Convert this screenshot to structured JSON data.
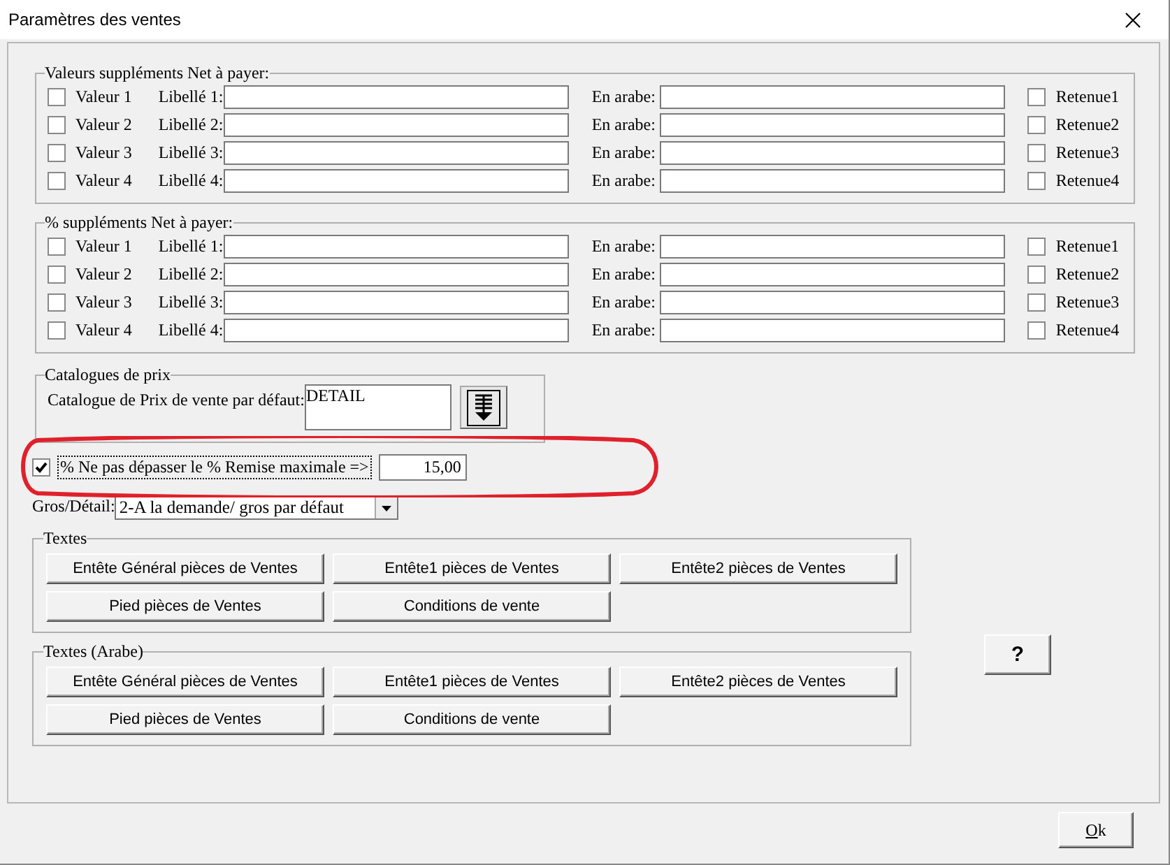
{
  "window": {
    "title": "Paramètres des ventes"
  },
  "supplement_groups": [
    {
      "title": "Valeurs suppléments Net à payer:",
      "rows": [
        {
          "checked": false,
          "label": "Valeur 1",
          "libelle": "Libellé 1:",
          "arabe": "En arabe:",
          "retenue_checked": false,
          "retenue": "Retenue1"
        },
        {
          "checked": false,
          "label": "Valeur 2",
          "libelle": "Libellé 2:",
          "arabe": "En arabe:",
          "retenue_checked": false,
          "retenue": "Retenue2"
        },
        {
          "checked": false,
          "label": "Valeur 3",
          "libelle": "Libellé 3:",
          "arabe": "En arabe:",
          "retenue_checked": false,
          "retenue": "Retenue3"
        },
        {
          "checked": false,
          "label": "Valeur 4",
          "libelle": "Libellé 4:",
          "arabe": "En arabe:",
          "retenue_checked": false,
          "retenue": "Retenue4"
        }
      ]
    },
    {
      "title": "% suppléments Net à payer:",
      "rows": [
        {
          "checked": false,
          "label": "Valeur 1",
          "libelle": "Libellé 1:",
          "arabe": "En arabe:",
          "retenue_checked": false,
          "retenue": "Retenue1"
        },
        {
          "checked": false,
          "label": "Valeur 2",
          "libelle": "Libellé 2:",
          "arabe": "En arabe:",
          "retenue_checked": false,
          "retenue": "Retenue2"
        },
        {
          "checked": false,
          "label": "Valeur 3",
          "libelle": "Libellé 3:",
          "arabe": "En arabe:",
          "retenue_checked": false,
          "retenue": "Retenue3"
        },
        {
          "checked": false,
          "label": "Valeur 4",
          "libelle": "Libellé 4:",
          "arabe": "En arabe:",
          "retenue_checked": false,
          "retenue": "Retenue4"
        }
      ]
    }
  ],
  "catalogue": {
    "title": "Catalogues de prix",
    "label": "Catalogue de Prix de vente par défaut:",
    "value": "DETAIL"
  },
  "remise": {
    "checked": true,
    "focused": true,
    "label": "% Ne pas dépasser le % Remise maximale =>",
    "value": "15,00"
  },
  "gros_detail": {
    "label": "Gros/Détail:",
    "value": "2-A la demande/ gros par défaut"
  },
  "text_groups": [
    {
      "title": "Textes",
      "buttons": [
        "Entête Général pièces de Ventes",
        "Entête1 pièces de Ventes",
        "Entête2 pièces de Ventes",
        "Pied pièces de Ventes",
        "Conditions de vente"
      ]
    },
    {
      "title": "Textes (Arabe)",
      "buttons": [
        "Entête Général pièces de Ventes",
        "Entête1 pièces de Ventes",
        "Entête2 pièces de Ventes",
        "Pied pièces de Ventes",
        "Conditions de vente"
      ]
    }
  ],
  "help_button": "?",
  "ok_button": "Ok"
}
